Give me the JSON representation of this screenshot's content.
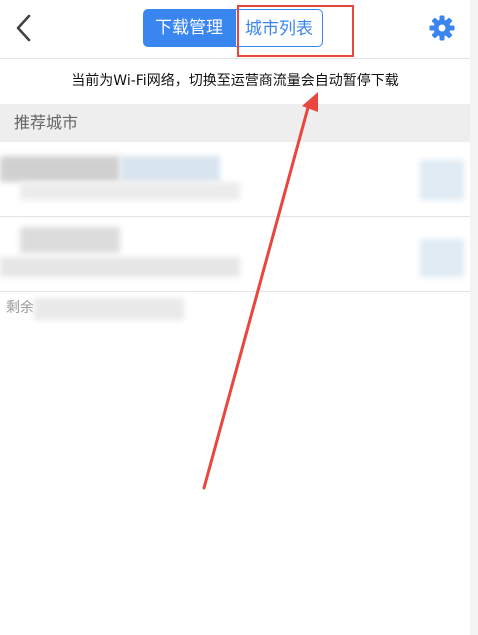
{
  "header": {
    "back_icon": "chevron-left-icon",
    "tabs": [
      {
        "label": "下载管理",
        "active": true
      },
      {
        "label": "城市列表",
        "active": false
      }
    ],
    "settings_icon": "gear-icon"
  },
  "notice": {
    "text": "当前为Wi-Fi网络，切换至运营商流量会自动暂停下载"
  },
  "section": {
    "title": "推荐城市"
  },
  "footer": {
    "remaining_prefix": "剩余"
  },
  "colors": {
    "accent": "#3a86f0",
    "annotation": "#e8463f",
    "section_bg": "#eeeeee"
  }
}
